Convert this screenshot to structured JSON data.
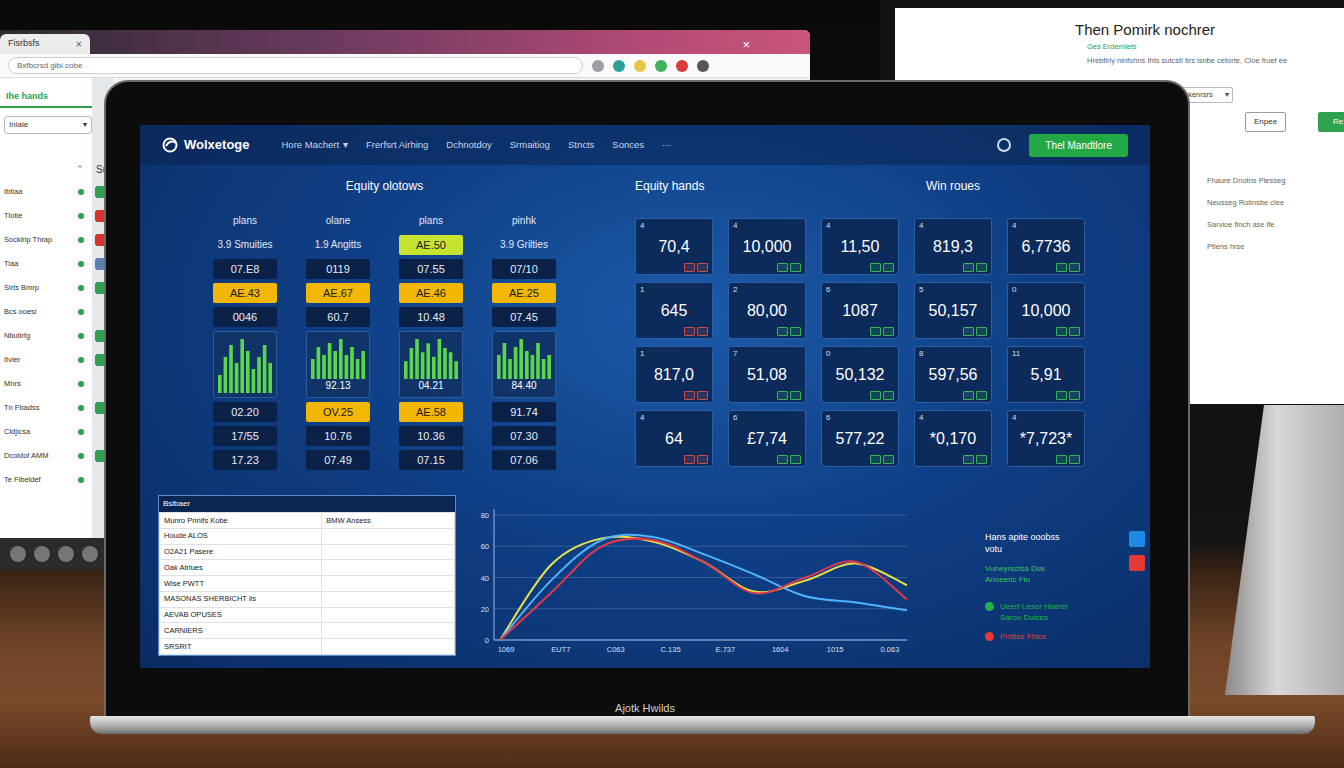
{
  "browser_window": {
    "tab": {
      "label": "Fisrbsfs",
      "close": "×"
    },
    "window_close": "×",
    "address": "Bxfbcrsd gibi.cobe",
    "heading": "Ihe hands",
    "select": {
      "value": "Iniaie",
      "caret": "▾"
    },
    "section": {
      "toggle": "⌃",
      "label": "Su"
    },
    "sidebar": {
      "items": [
        {
          "label": "Ibtiaa",
          "icon_color": "#2e9e4f"
        },
        {
          "label": "Tlotie",
          "icon_color": "#d9342b"
        },
        {
          "label": "Sockirip Thrap",
          "icon_color": "#d9342b"
        },
        {
          "label": "Tiaa",
          "icon_color": "#5b7fb8"
        },
        {
          "label": "Sirts Bmrp",
          "icon_color": "#2e9e4f"
        },
        {
          "label": "Bcs ooesi",
          "icon_color": "#e6e9ec"
        },
        {
          "label": "Nbutirtg",
          "icon_color": "#2e9e4f"
        },
        {
          "label": "Itvier",
          "icon_color": "#2e9e4f"
        },
        {
          "label": "Mnrs",
          "icon_color": "#e6e9ec"
        },
        {
          "label": "Tn Fbadss",
          "icon_color": "#2e9e4f"
        },
        {
          "label": "Cldjicsa",
          "icon_color": "#e6e9ec"
        },
        {
          "label": "Dcoldof AMM",
          "icon_color": "#2e9e4f"
        },
        {
          "label": "Te Fibeldef",
          "icon_color": "#e6e9ec"
        }
      ]
    }
  },
  "monitor_window": {
    "title": "Then Pomirk nochrer",
    "lines": [
      {
        "text": "Ges Erdemlets",
        "color": "#2e9e4f"
      },
      {
        "text": "Hrebfirly ninfohns  Ihts sutcstl tirs isnbe cetorte, Cloe fruef ee",
        "color": "#666666"
      }
    ],
    "select": {
      "value": "Cskenrsrs",
      "caret": "▾"
    },
    "buttons": [
      {
        "label": "Enpee",
        "kind": "outline"
      },
      {
        "label": "Re",
        "kind": "solid"
      }
    ],
    "notes": [
      "Fhaure Dnotns Plesseg",
      "Neusseg Rotinsbe clee",
      "Sarvioe flnch ase lfe",
      "Ptiens hrse"
    ]
  },
  "laptop": {
    "brand": "Ajotk Hwilds",
    "app": {
      "logo": "Wolxetoge",
      "nav": [
        {
          "label": "Hore Machert",
          "caret": "▾"
        },
        {
          "label": "Frerfsrt Airhing"
        },
        {
          "label": "Dchnotdoy"
        },
        {
          "label": "Srmaitiog"
        },
        {
          "label": "Stncts"
        },
        {
          "label": "Sonces"
        },
        {
          "label": "···"
        }
      ],
      "action_button": "Thel Mandtlore",
      "equity": {
        "title": "Equity olotows",
        "columns": [
          {
            "header": "plans",
            "cells": [
              {
                "kind": "text",
                "text": "3.9 Smuities"
              },
              {
                "kind": "cell",
                "text": "07.E8",
                "color": "#0b2148"
              },
              {
                "kind": "cell",
                "text": "AE.43",
                "color": "#f2b705"
              },
              {
                "kind": "cell",
                "text": "0046",
                "color": "#0b2148"
              },
              {
                "kind": "chart",
                "values": [
                  3,
                  6,
                  8,
                  5,
                  9,
                  7,
                  4,
                  6,
                  8,
                  5
                ]
              },
              {
                "kind": "cell",
                "text": "02.20",
                "color": "#0b2148"
              },
              {
                "kind": "cell",
                "text": "17/55",
                "color": "#0b2148"
              },
              {
                "kind": "cell",
                "text": "17.23",
                "color": "#0b2148"
              }
            ]
          },
          {
            "header": "olane",
            "cells": [
              {
                "kind": "text",
                "text": "1.9 Angitts"
              },
              {
                "kind": "cell",
                "text": "0119",
                "color": "#0b2148"
              },
              {
                "kind": "cell",
                "text": "AE.67",
                "color": "#f2b705"
              },
              {
                "kind": "cell",
                "text": "60.7",
                "color": "#0b2148"
              },
              {
                "kind": "chart",
                "values": [
                  5,
                  8,
                  6,
                  9,
                  7,
                  10,
                  6,
                  8,
                  5,
                  7
                ],
                "label": "92.13"
              },
              {
                "kind": "cell",
                "text": "OV.25",
                "color": "#f2b705"
              },
              {
                "kind": "cell",
                "text": "10.76",
                "color": "#0b2148"
              },
              {
                "kind": "cell",
                "text": "07.49",
                "color": "#0b2148"
              }
            ]
          },
          {
            "header": "plans",
            "cells": [
              {
                "kind": "cell",
                "text": "AE.50",
                "color": "#c6e32f"
              },
              {
                "kind": "cell",
                "text": "07.55",
                "color": "#0b2148"
              },
              {
                "kind": "cell",
                "text": "AE.46",
                "color": "#f2b705"
              },
              {
                "kind": "cell",
                "text": "10.48",
                "color": "#0b2148"
              },
              {
                "kind": "chart",
                "values": [
                  4,
                  7,
                  9,
                  6,
                  8,
                  5,
                  9,
                  7,
                  6,
                  4
                ],
                "label": "04.21"
              },
              {
                "kind": "cell",
                "text": "AE.58",
                "color": "#f2b705"
              },
              {
                "kind": "cell",
                "text": "10.36",
                "color": "#0b2148"
              },
              {
                "kind": "cell",
                "text": "07.15",
                "color": "#0b2148"
              }
            ]
          },
          {
            "header": "pinhk",
            "cells": [
              {
                "kind": "text",
                "text": "3.9 Grilties"
              },
              {
                "kind": "cell",
                "text": "07/10",
                "color": "#0b2148"
              },
              {
                "kind": "cell",
                "text": "AE.25",
                "color": "#f2b705"
              },
              {
                "kind": "cell",
                "text": "07.45",
                "color": "#0b2148"
              },
              {
                "kind": "chart",
                "values": [
                  6,
                  9,
                  5,
                  8,
                  10,
                  7,
                  6,
                  9,
                  5,
                  6
                ],
                "label": "84.40"
              },
              {
                "kind": "cell",
                "text": "91.74",
                "color": "#0b2148"
              },
              {
                "kind": "cell",
                "text": "07.30",
                "color": "#0b2148"
              },
              {
                "kind": "cell",
                "text": "07.06",
                "color": "#0b2148"
              }
            ]
          }
        ]
      },
      "tiles": {
        "titles": [
          "Equity hands",
          "Win roues"
        ],
        "items": [
          {
            "index": "4",
            "value": "70,4",
            "icon_color": "#c94a4a"
          },
          {
            "index": "4",
            "value": "10,000",
            "icon_color": "#3bb35a"
          },
          {
            "index": "4",
            "value": "11,50",
            "icon_color": "#3bb35a"
          },
          {
            "index": "4",
            "value": "819,3",
            "icon_color": "#3bb35a"
          },
          {
            "index": "4",
            "value": "6,7736",
            "icon_color": "#3bb35a"
          },
          {
            "index": "1",
            "value": "645",
            "icon_color": "#c94a4a"
          },
          {
            "index": "2",
            "value": "80,00",
            "icon_color": "#3bb35a"
          },
          {
            "index": "6",
            "value": "1087",
            "icon_color": "#3bb35a"
          },
          {
            "index": "5",
            "value": "50,157",
            "icon_color": "#3bb35a"
          },
          {
            "index": "0",
            "value": "10,000",
            "icon_color": "#3bb35a"
          },
          {
            "index": "1",
            "value": "817,0",
            "icon_color": "#c94a4a"
          },
          {
            "index": "7",
            "value": "51,08",
            "icon_color": "#3bb35a"
          },
          {
            "index": "0",
            "value": "50,132",
            "icon_color": "#3bb35a"
          },
          {
            "index": "8",
            "value": "597,56",
            "icon_color": "#3bb35a"
          },
          {
            "index": "11",
            "value": "5,91",
            "icon_color": "#3bb35a"
          },
          {
            "index": "4",
            "value": "64",
            "icon_color": "#c94a4a"
          },
          {
            "index": "6",
            "value": "£7,74",
            "icon_color": "#3bb35a"
          },
          {
            "index": "6",
            "value": "577,22",
            "icon_color": "#3bb35a"
          },
          {
            "index": "4",
            "value": "*0,170",
            "icon_color": "#3bb35a"
          },
          {
            "index": "4",
            "value": "*7,723*",
            "icon_color": "#3bb35a"
          }
        ]
      },
      "table": {
        "title": "Bsibaer",
        "columns": [
          "Munro Prinifs Kobe",
          "BMW Ansess"
        ],
        "rows": [
          [
            "Houde ALOS"
          ],
          [
            "O2A21 Pasere"
          ],
          [
            "Oak Atrlues"
          ],
          [
            "Wise PWTT"
          ],
          [
            "MASONAS SHERBICHT lis"
          ],
          [
            "AEVAB OPUSES"
          ],
          [
            "CARNIERS"
          ],
          [
            "SRSRIT"
          ]
        ]
      },
      "chart": {
        "y_ticks": [
          "80",
          "60",
          "40",
          "20",
          "0"
        ],
        "x_ticks": [
          "1069",
          "EUT7",
          "C063",
          "C.135",
          "E.737",
          "1604",
          "1015",
          "0.063"
        ],
        "series": [
          {
            "color": "#e8e24a",
            "values": [
              0,
              48,
              65,
              63,
              50,
              31,
              38,
              49,
              35
            ]
          },
          {
            "color": "#4fb3ff",
            "values": [
              0,
              38,
              64,
              66,
              55,
              42,
              28,
              24,
              19
            ]
          },
          {
            "color": "#e0394a",
            "values": [
              0,
              30,
              60,
              64,
              50,
              30,
              40,
              50,
              26
            ]
          }
        ]
      },
      "legend": {
        "title": "Hans apite ooobss",
        "subtitle": "votu",
        "note": [
          "Vuneyrsctsa Diai",
          "Arioeeric Fiu"
        ],
        "toggles": [
          {
            "color": "#1e88e5"
          },
          {
            "color": "#e53935"
          }
        ],
        "items": [
          {
            "label": "Ueerf Leser Hlatrer",
            "sub": "Sarou Duices",
            "color": "#22b14c"
          },
          {
            "label": "Pottlse Fhice",
            "color": "#e53935"
          }
        ]
      }
    }
  }
}
